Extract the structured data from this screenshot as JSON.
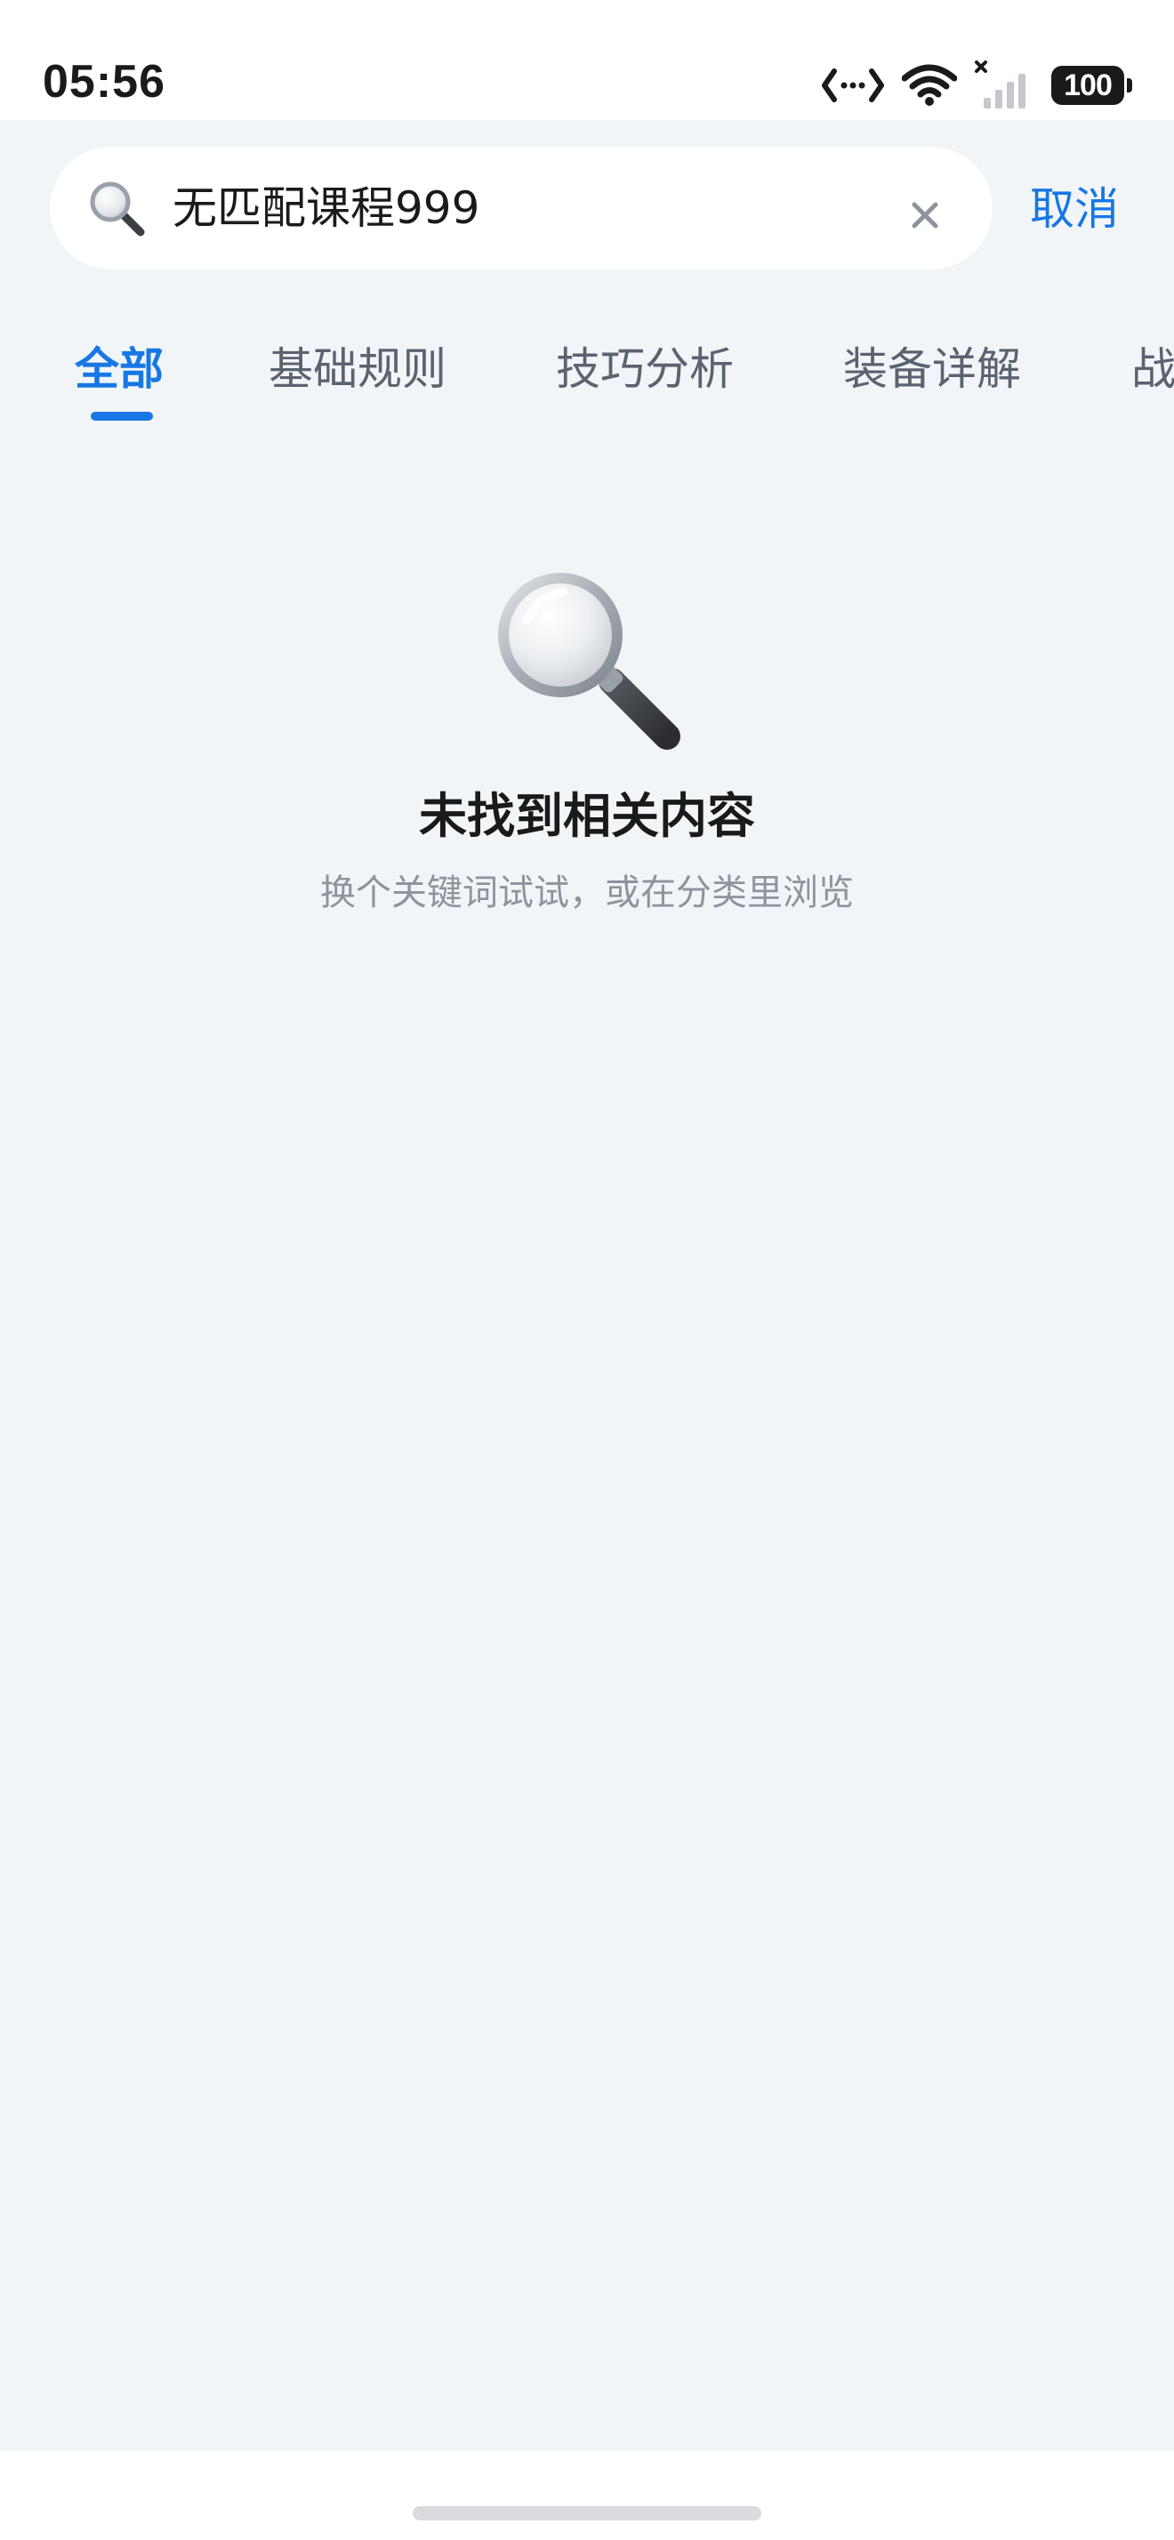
{
  "status_bar": {
    "time": "05:56",
    "battery_level": "100",
    "icons": [
      "data-transfer-icon",
      "wifi-icon",
      "cellular-no-signal-icon",
      "battery-icon"
    ]
  },
  "search": {
    "query": "无匹配课程999",
    "cancel_label": "取消",
    "search_icon": "magnifier-icon",
    "clear_icon": "close-icon"
  },
  "tabs": {
    "items": [
      {
        "label": "全部",
        "active": true
      },
      {
        "label": "基础规则",
        "active": false
      },
      {
        "label": "技巧分析",
        "active": false
      },
      {
        "label": "装备详解",
        "active": false
      },
      {
        "label": "战",
        "active": false
      }
    ]
  },
  "empty_state": {
    "icon": "magnifier-illustration-icon",
    "title": "未找到相关内容",
    "subtitle": "换个关键词试试，或在分类里浏览"
  },
  "colors": {
    "accent": "#1677e5",
    "page_background": "#f2f5f8",
    "muted_text": "#8e949e"
  }
}
